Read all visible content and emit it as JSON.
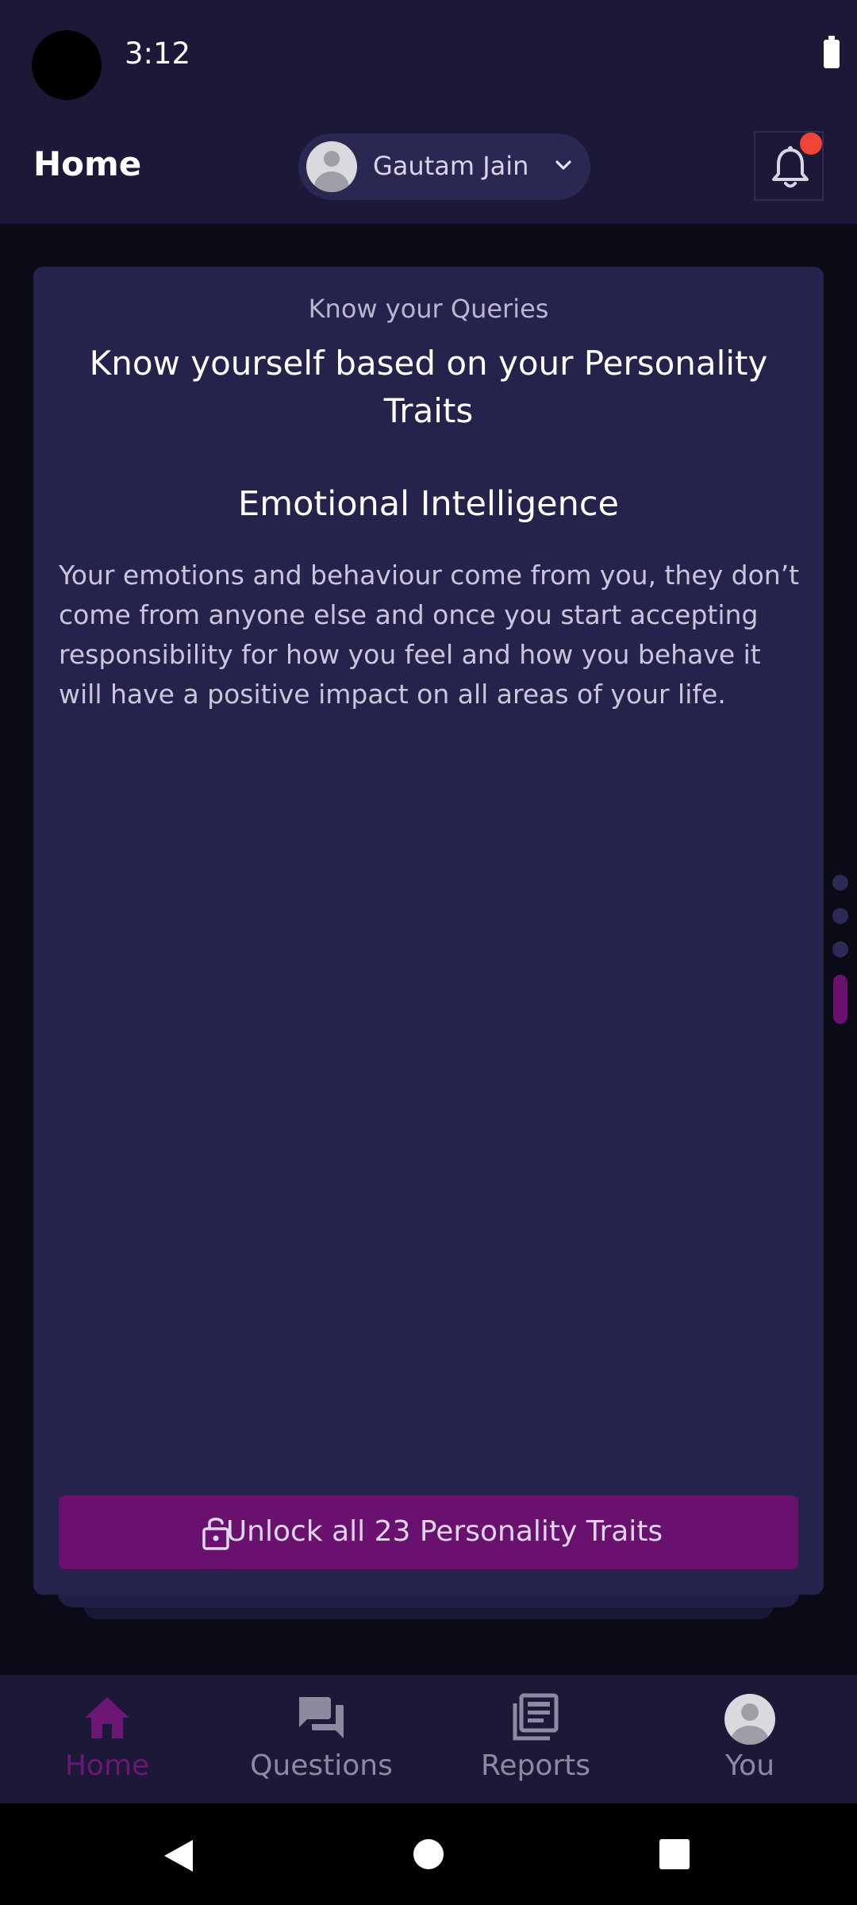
{
  "status_bar": {
    "time": "3:12"
  },
  "header": {
    "title": "Home",
    "profile_name": "Gautam Jain",
    "icons": [
      "chevron-down-icon",
      "bell-icon"
    ]
  },
  "card": {
    "kicker": "Know your Queries",
    "heading": "Know yourself based on your Personality Traits",
    "trait_title": "Emotional Intelligence",
    "trait_body": "Your emotions and behaviour come from you, they don’t come from anyone else and once you start accepting responsibility for how you feel and how you behave it will have a positive impact on all areas of your life.",
    "unlock_label": "Unlock all 23 Personality Traits"
  },
  "pager": {
    "count": 4,
    "active_index": 3
  },
  "bottom_nav": {
    "items": [
      {
        "label": "Home",
        "icon": "home-icon",
        "active": true
      },
      {
        "label": "Questions",
        "icon": "chat-icon",
        "active": false
      },
      {
        "label": "Reports",
        "icon": "reports-icon",
        "active": false
      },
      {
        "label": "You",
        "icon": "avatar",
        "active": false
      }
    ]
  },
  "colors": {
    "background": "#0b0a17",
    "bar": "#1b1838",
    "card": "#25234c",
    "accent": "#6a1170",
    "notification": "#f04438"
  }
}
